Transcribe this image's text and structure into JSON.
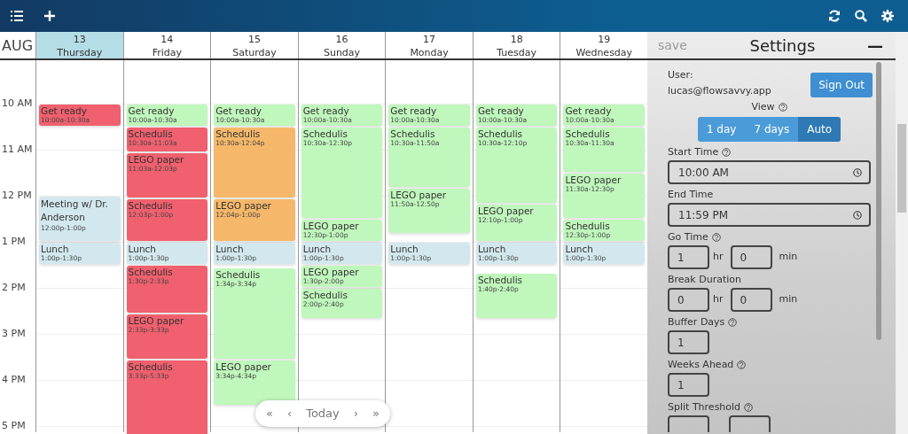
{
  "calendar": {
    "month": "AUG",
    "hours": [
      "10 AM",
      "11 AM",
      "12 PM",
      "1 PM",
      "2 PM",
      "3 PM",
      "4 PM",
      "5 PM"
    ],
    "days": [
      {
        "date": "13",
        "weekday": "Thursday",
        "selected": true,
        "events": [
          {
            "title": "Get ready",
            "time": "10:00a-10:30a",
            "color": "#f0606e"
          },
          {
            "title": "Meeting w/ Dr. Anderson",
            "time": "12:00p-1:00p",
            "color": "#d3e7ee"
          },
          {
            "title": "Lunch",
            "time": "1:00p-1:30p",
            "color": "#d3e7ee"
          }
        ]
      },
      {
        "date": "14",
        "weekday": "Friday",
        "selected": false,
        "events": [
          {
            "title": "Get ready",
            "time": "10:00a-10:30a",
            "color": "#c0f7bc"
          },
          {
            "title": "Schedulis",
            "time": "10:30a-11:03a",
            "color": "#f0606e"
          },
          {
            "title": "LEGO paper",
            "time": "11:03a-12:03p",
            "color": "#f0606e"
          },
          {
            "title": "Schedulis",
            "time": "12:03p-1:00p",
            "color": "#f0606e"
          },
          {
            "title": "Lunch",
            "time": "1:00p-1:30p",
            "color": "#d3e7ee"
          },
          {
            "title": "Schedulis",
            "time": "1:30p-2:33p",
            "color": "#f0606e"
          },
          {
            "title": "LEGO paper",
            "time": "2:33p-3:33p",
            "color": "#f0606e"
          },
          {
            "title": "Schedulis",
            "time": "3:33p-5:33p",
            "color": "#f0606e"
          }
        ]
      },
      {
        "date": "15",
        "weekday": "Saturday",
        "selected": false,
        "events": [
          {
            "title": "Get ready",
            "time": "10:00a-10:30a",
            "color": "#c0f7bc"
          },
          {
            "title": "Schedulis",
            "time": "10:30a-12:04p",
            "color": "#f5b86a"
          },
          {
            "title": "LEGO paper",
            "time": "12:04p-1:00p",
            "color": "#f5b86a"
          },
          {
            "title": "Lunch",
            "time": "1:00p-1:30p",
            "color": "#d3e7ee"
          },
          {
            "title": "Schedulis",
            "time": "1:34p-3:34p",
            "color": "#c0f7bc"
          },
          {
            "title": "LEGO paper",
            "time": "3:34p-4:34p",
            "color": "#c0f7bc"
          }
        ]
      },
      {
        "date": "16",
        "weekday": "Sunday",
        "selected": false,
        "events": [
          {
            "title": "Get ready",
            "time": "10:00a-10:30a",
            "color": "#c0f7bc"
          },
          {
            "title": "Schedulis",
            "time": "10:30a-12:30p",
            "color": "#c0f7bc"
          },
          {
            "title": "LEGO paper",
            "time": "12:30p-1:00p",
            "color": "#c0f7bc"
          },
          {
            "title": "Lunch",
            "time": "1:00p-1:30p",
            "color": "#d3e7ee"
          },
          {
            "title": "LEGO paper",
            "time": "1:30p-2:00p",
            "color": "#c0f7bc"
          },
          {
            "title": "Schedulis",
            "time": "2:00p-2:40p",
            "color": "#c0f7bc"
          }
        ]
      },
      {
        "date": "17",
        "weekday": "Monday",
        "selected": false,
        "events": [
          {
            "title": "Get ready",
            "time": "10:00a-10:30a",
            "color": "#c0f7bc"
          },
          {
            "title": "Schedulis",
            "time": "10:30a-11:50a",
            "color": "#c0f7bc"
          },
          {
            "title": "LEGO paper",
            "time": "11:50a-12:50p",
            "color": "#c0f7bc"
          },
          {
            "title": "Lunch",
            "time": "1:00p-1:30p",
            "color": "#d3e7ee"
          }
        ]
      },
      {
        "date": "18",
        "weekday": "Tuesday",
        "selected": false,
        "events": [
          {
            "title": "Get ready",
            "time": "10:00a-10:30a",
            "color": "#c0f7bc"
          },
          {
            "title": "Schedulis",
            "time": "10:30a-12:10p",
            "color": "#c0f7bc"
          },
          {
            "title": "LEGO paper",
            "time": "12:10p-1:00p",
            "color": "#c0f7bc"
          },
          {
            "title": "Lunch",
            "time": "1:00p-1:30p",
            "color": "#d3e7ee"
          },
          {
            "title": "Schedulis",
            "time": "1:40p-2:40p",
            "color": "#c0f7bc"
          }
        ]
      },
      {
        "date": "19",
        "weekday": "Wednesday",
        "selected": false,
        "events": [
          {
            "title": "Get ready",
            "time": "10:00a-10:30a",
            "color": "#c0f7bc"
          },
          {
            "title": "Schedulis",
            "time": "10:30a-11:30a",
            "color": "#c0f7bc"
          },
          {
            "title": "LEGO paper",
            "time": "11:30a-12:30p",
            "color": "#c0f7bc"
          },
          {
            "title": "Schedulis",
            "time": "12:30p-1:00p",
            "color": "#c0f7bc"
          },
          {
            "title": "Lunch",
            "time": "1:00p-1:30p",
            "color": "#d3e7ee"
          }
        ]
      }
    ],
    "nav": {
      "first": "«",
      "prev": "‹",
      "today": "Today",
      "next": "›",
      "last": "»"
    }
  },
  "settings": {
    "save": {
      "label": "save",
      "disabled": true
    },
    "title": "Settings",
    "collapse": "—",
    "user_label": "User:",
    "user_email": "lucas@flowsavvy.app",
    "sign_out": "Sign Out",
    "view": {
      "label": "View",
      "options": [
        {
          "label": "1 day",
          "selected": false
        },
        {
          "label": "7 days",
          "selected": false
        },
        {
          "label": "Auto",
          "selected": true
        }
      ]
    },
    "fields": [
      {
        "kind": "time",
        "label": "Start Time",
        "help": true,
        "value": "10:00 AM"
      },
      {
        "kind": "time",
        "label": "End Time",
        "help": false,
        "value": "11:59 PM"
      },
      {
        "kind": "duration",
        "label": "Go Time",
        "help": true,
        "hours": "1",
        "hr_unit": "hr",
        "minutes": "0",
        "min_unit": "min"
      },
      {
        "kind": "duration",
        "label": "Break Duration",
        "help": false,
        "hours": "0",
        "hr_unit": "hr",
        "minutes": "0",
        "min_unit": "min"
      },
      {
        "kind": "number",
        "label": "Buffer Days",
        "help": true,
        "value": "1"
      },
      {
        "kind": "number",
        "label": "Weeks Ahead",
        "help": true,
        "value": "1"
      },
      {
        "kind": "duration",
        "label": "Split Threshold",
        "help": true
      }
    ]
  }
}
